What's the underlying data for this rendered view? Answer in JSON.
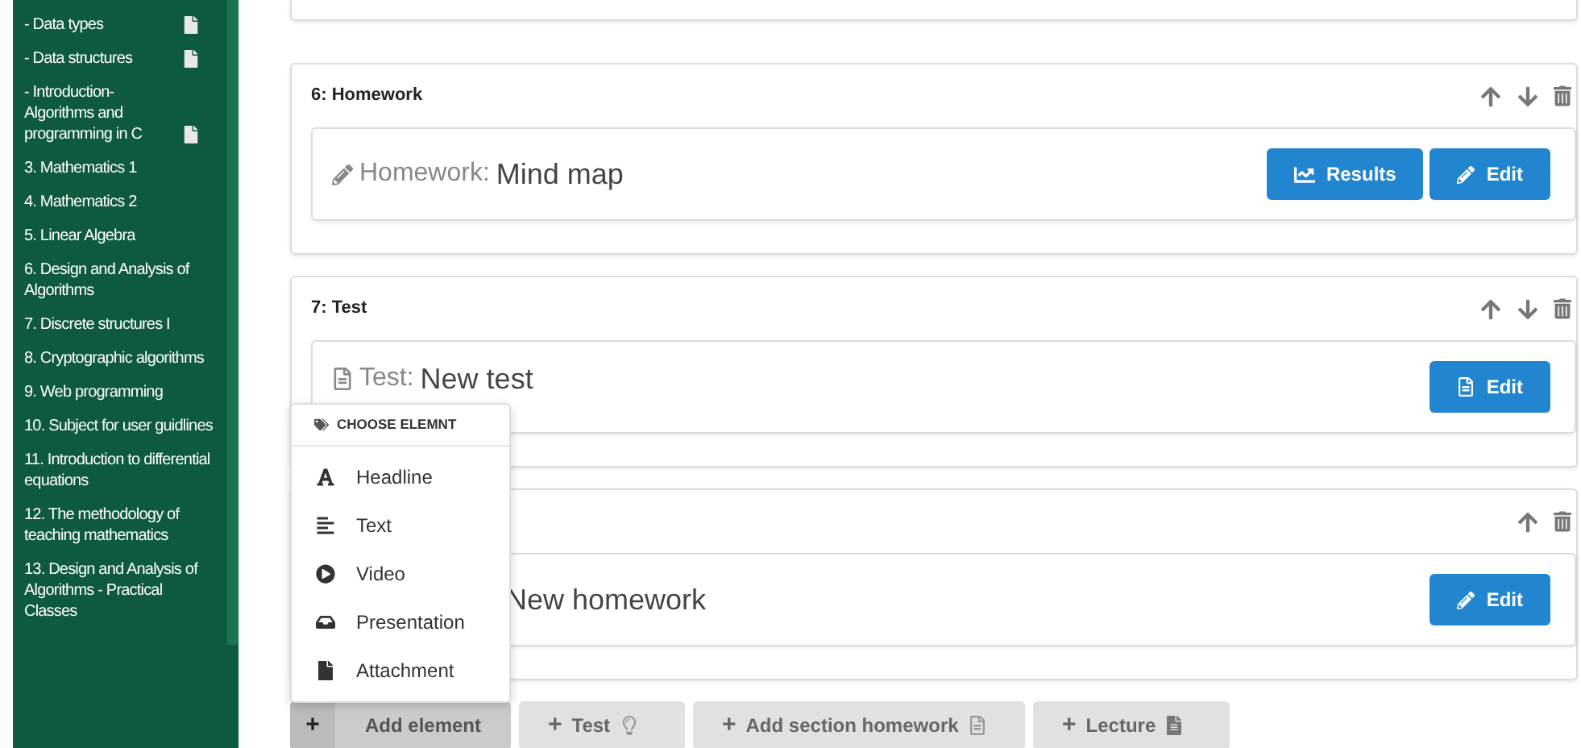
{
  "sidebar": {
    "items": [
      {
        "label": "- Data types",
        "has_file": true
      },
      {
        "label": "- Data structures",
        "has_file": true
      },
      {
        "label": "- Introduction-Algorithms and programming in C",
        "has_file": true
      },
      {
        "label": "3. Mathematics 1",
        "has_file": false
      },
      {
        "label": "4. Mathematics 2",
        "has_file": false
      },
      {
        "label": "5. Linear Algebra",
        "has_file": false
      },
      {
        "label": "6. Design and Analysis of Algorithms",
        "has_file": false
      },
      {
        "label": "7. Discrete structures I",
        "has_file": false
      },
      {
        "label": "8. Cryptographic algorithms",
        "has_file": false
      },
      {
        "label": "9. Web programming",
        "has_file": false
      },
      {
        "label": "10. Subject for user guidlines",
        "has_file": false
      },
      {
        "label": "11. Introduction to differential equations",
        "has_file": false
      },
      {
        "label": "12. The methodology of teaching mathematics",
        "has_file": false
      },
      {
        "label": "13. Design and Analysis of Algorithms - Practical Classes",
        "has_file": false
      }
    ]
  },
  "sections": [
    {
      "heading": "6: Homework",
      "kind": "homework",
      "move_up": true,
      "move_down": true,
      "type_label": "Homework:",
      "title": "Mind map",
      "buttons": [
        {
          "label": "Results",
          "kind": "results"
        },
        {
          "label": "Edit",
          "kind": "edit"
        }
      ]
    },
    {
      "heading": "7: Test",
      "kind": "test",
      "move_up": true,
      "move_down": true,
      "type_label": "Test:",
      "title": "New test",
      "buttons": [
        {
          "label": "Edit",
          "kind": "edit-file"
        }
      ]
    },
    {
      "kind": "homework-covered",
      "move_up": true,
      "move_down": false,
      "title": "New homework",
      "buttons": [
        {
          "label": "Edit",
          "kind": "edit"
        }
      ]
    }
  ],
  "dropdown": {
    "title": "CHOOSE ELEMNT",
    "items": [
      {
        "label": "Headline",
        "kind": "headline"
      },
      {
        "label": "Text",
        "kind": "text"
      },
      {
        "label": "Video",
        "kind": "video"
      },
      {
        "label": "Presentation",
        "kind": "presentation"
      },
      {
        "label": "Attachment",
        "kind": "attachment"
      }
    ]
  },
  "toolbar": [
    {
      "label": "Add element",
      "kind": "add-element",
      "icon": "+"
    },
    {
      "label": "Test",
      "kind": "test",
      "icon": "+"
    },
    {
      "label": "Add section homework",
      "kind": "homework",
      "icon": "+"
    },
    {
      "label": "Lecture",
      "kind": "lecture",
      "icon": "+"
    }
  ]
}
